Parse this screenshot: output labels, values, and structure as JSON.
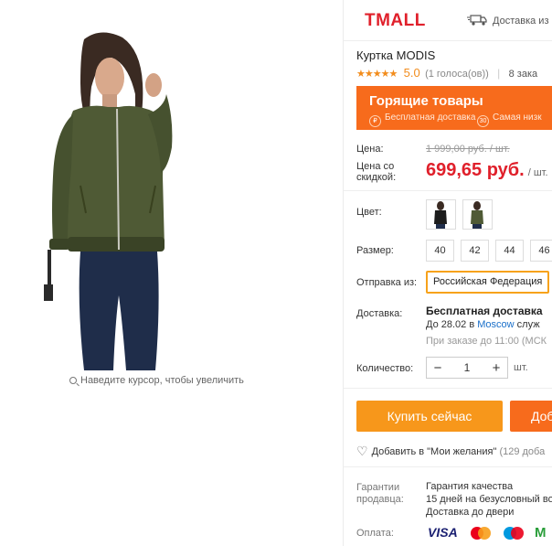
{
  "zoom_hint": "Наведите курсор, чтобы увеличить",
  "header": {
    "logo": "TMALL",
    "delivery": "Доставка из"
  },
  "product": {
    "title": "Куртка MODIS",
    "rating_stars": "★★★★★",
    "rating": "5.0",
    "votes": "(1 голоса(ов))",
    "orders": "8 зака"
  },
  "banner": {
    "title": "Горящие товары",
    "feature1_icon": "₽",
    "feature1": "Бесплатная доставка",
    "feature2_icon": "30",
    "feature2": "Самая низк"
  },
  "price": {
    "label": "Цена:",
    "old": "1 999,00 руб. / шт.",
    "discount_label_1": "Цена со",
    "discount_label_2": "скидкой:",
    "new": "699,65 руб.",
    "unit": "/ шт."
  },
  "color": {
    "label": "Цвет:"
  },
  "size": {
    "label": "Размер:",
    "options": [
      "40",
      "42",
      "44",
      "46"
    ]
  },
  "shipping": {
    "label": "Отправка из:",
    "value": "Российская Федерация"
  },
  "delivery": {
    "label": "Доставка:",
    "title": "Бесплатная доставка",
    "date_prefix": "До 28.02 в",
    "city": "Moscow",
    "date_suffix": "служ",
    "order_note": "При заказе до 11:00 (МСК"
  },
  "quantity": {
    "label": "Количество:",
    "minus": "−",
    "value": "1",
    "plus": "+",
    "unit": "шт."
  },
  "actions": {
    "buy": "Купить сейчас",
    "cart": "Доб"
  },
  "wishlist": {
    "label": "Добавить в \"Мои желания\"",
    "count": "(129 доба"
  },
  "guarantee": {
    "label_1": "Гарантии",
    "label_2": "продавца:",
    "items": [
      "Гарантия качества",
      "15 дней на безусловный во",
      "Доставка до двери"
    ]
  },
  "payment": {
    "label": "Оплата:",
    "visa": "VISA",
    "mir": "М"
  },
  "colors": {
    "red": "#e0202b",
    "orange": "#f7971b",
    "banner": "#f76b1c",
    "link": "#1a6fc9"
  }
}
